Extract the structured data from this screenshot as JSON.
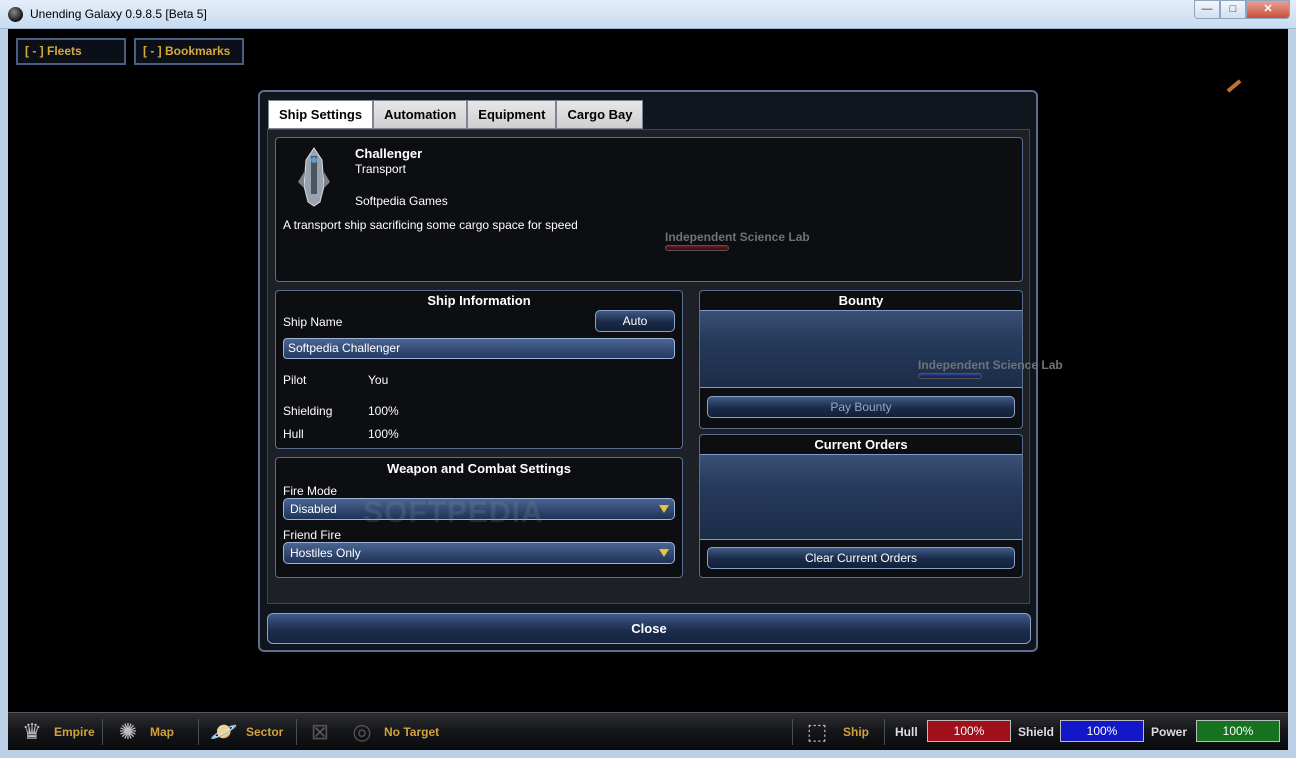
{
  "window": {
    "title": "Unending Galaxy 0.9.8.5 [Beta 5]",
    "minimize": "—",
    "maximize": "□",
    "close": "✕"
  },
  "top_buttons": {
    "fleets": "[ - ] Fleets",
    "bookmarks": "[ - ] Bookmarks"
  },
  "background_labels": {
    "science_lab_1": "Independent Science Lab",
    "science_lab_2": "Independent Science Lab"
  },
  "dialog": {
    "tabs": [
      "Ship Settings",
      "Automation",
      "Equipment",
      "Cargo Bay"
    ],
    "active_tab": "Ship Settings",
    "ship": {
      "name": "Challenger",
      "class": "Transport",
      "maker": "Softpedia Games",
      "description": "A transport ship sacrificing some cargo space for speed"
    },
    "ship_info": {
      "title": "Ship Information",
      "ship_name_label": "Ship Name",
      "auto_button": "Auto",
      "ship_name_value": "Softpedia Challenger",
      "pilot_label": "Pilot",
      "pilot_value": "You",
      "shielding_label": "Shielding",
      "shielding_value": "100%",
      "hull_label": "Hull",
      "hull_value": "100%"
    },
    "combat": {
      "title": "Weapon and Combat Settings",
      "fire_mode_label": "Fire Mode",
      "fire_mode_value": "Disabled",
      "friend_fire_label": "Friend Fire",
      "friend_fire_value": "Hostiles Only"
    },
    "bounty": {
      "title": "Bounty",
      "pay_button": "Pay Bounty"
    },
    "orders": {
      "title": "Current Orders",
      "clear_button": "Clear Current Orders"
    },
    "close_button": "Close",
    "watermark": "SOFTPEDIA"
  },
  "bottom_bar": {
    "empire": "Empire",
    "map": "Map",
    "sector": "Sector",
    "no_target": "No Target",
    "ship": "Ship",
    "hull_label": "Hull",
    "hull_value": "100%",
    "shield_label": "Shield",
    "shield_value": "100%",
    "power_label": "Power",
    "power_value": "100%"
  },
  "colors": {
    "hull_bar": "#a0101a",
    "shield_bar": "#1218c8",
    "power_bar": "#15721f",
    "accent_gold": "#d3a23c"
  }
}
